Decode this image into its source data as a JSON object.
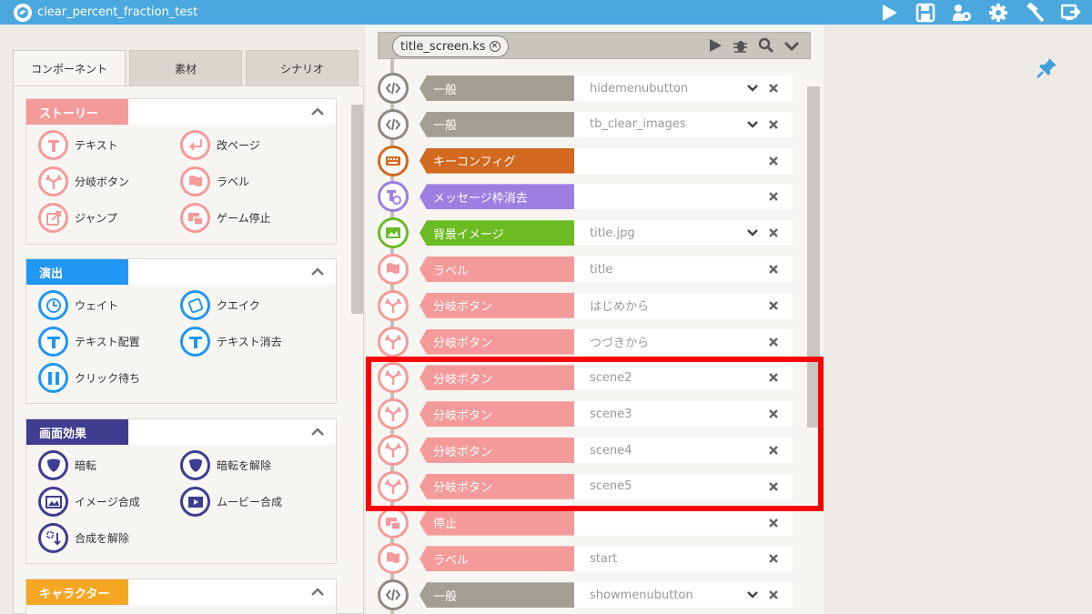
{
  "window": {
    "title": "clear_percent_fraction_test"
  },
  "titlebar_tools": [
    "play-icon",
    "save-icon",
    "users-gear-icon",
    "settings-gear-icon",
    "hammer-icon",
    "export-icon"
  ],
  "left": {
    "tabs": [
      "コンポーネント",
      "素材",
      "シナリオ"
    ],
    "sections": [
      {
        "label": "ストーリー",
        "color": "#f59a9a",
        "items": [
          {
            "label": "テキスト",
            "icon": "text-T-icon"
          },
          {
            "label": "改ページ",
            "icon": "new-page-icon"
          },
          {
            "label": "分岐ボタン",
            "icon": "branch-icon"
          },
          {
            "label": "ラベル",
            "icon": "label-flag-icon"
          },
          {
            "label": "ジャンプ",
            "icon": "jump-icon"
          },
          {
            "label": "ゲーム停止",
            "icon": "stop-game-icon"
          }
        ]
      },
      {
        "label": "演出",
        "color": "#2196f3",
        "items": [
          {
            "label": "ウェイト",
            "icon": "clock-icon"
          },
          {
            "label": "クエイク",
            "icon": "quake-icon"
          },
          {
            "label": "テキスト配置",
            "icon": "text-place-icon"
          },
          {
            "label": "テキスト消去",
            "icon": "text-clear-icon"
          },
          {
            "label": "クリック待ち",
            "icon": "pause-icon"
          }
        ]
      },
      {
        "label": "画面効果",
        "color": "#3f3d8f",
        "items": [
          {
            "label": "暗転",
            "icon": "fade-out-icon"
          },
          {
            "label": "暗転を解除",
            "icon": "fade-in-icon"
          },
          {
            "label": "イメージ合成",
            "icon": "image-composite-icon"
          },
          {
            "label": "ムービー合成",
            "icon": "movie-composite-icon"
          },
          {
            "label": "合成を解除",
            "icon": "composite-release-icon"
          }
        ]
      },
      {
        "label": "キャラクター",
        "color": "#f5a623",
        "items": []
      }
    ]
  },
  "editor": {
    "file_tab": "title_screen.ks",
    "rows": [
      {
        "tag": "一般",
        "value": "hidemenubutton",
        "color": "#a39e93",
        "icon": "code-icon",
        "dropdown": true
      },
      {
        "tag": "一般",
        "value": "tb_clear_images",
        "color": "#a39e93",
        "icon": "code-icon",
        "dropdown": true
      },
      {
        "tag": "キーコンフィグ",
        "value": "",
        "color": "#d2691e",
        "icon": "keyboard-icon",
        "dropdown": false
      },
      {
        "tag": "メッセージ枠消去",
        "value": "",
        "color": "#9c7fe0",
        "icon": "message-clear-icon",
        "dropdown": false
      },
      {
        "tag": "背景イメージ",
        "value": "title.jpg",
        "color": "#6cbb22",
        "icon": "background-image-icon",
        "dropdown": true
      },
      {
        "tag": "ラベル",
        "value": "title",
        "color": "#f59a9a",
        "icon": "label-flag-icon",
        "dropdown": false
      },
      {
        "tag": "分岐ボタン",
        "value": "はじめから",
        "color": "#f59a9a",
        "icon": "branch-icon",
        "dropdown": false
      },
      {
        "tag": "分岐ボタン",
        "value": "つづきから",
        "color": "#f59a9a",
        "icon": "branch-icon",
        "dropdown": false
      },
      {
        "tag": "分岐ボタン",
        "value": "scene2",
        "color": "#f59a9a",
        "icon": "branch-icon",
        "dropdown": false
      },
      {
        "tag": "分岐ボタン",
        "value": "scene3",
        "color": "#f59a9a",
        "icon": "branch-icon",
        "dropdown": false
      },
      {
        "tag": "分岐ボタン",
        "value": "scene4",
        "color": "#f59a9a",
        "icon": "branch-icon",
        "dropdown": false
      },
      {
        "tag": "分岐ボタン",
        "value": "scene5",
        "color": "#f59a9a",
        "icon": "branch-icon",
        "dropdown": false
      },
      {
        "tag": "停止",
        "value": "",
        "color": "#f59a9a",
        "icon": "stop-game-icon",
        "dropdown": false
      },
      {
        "tag": "ラベル",
        "value": "start",
        "color": "#f59a9a",
        "icon": "label-flag-icon",
        "dropdown": false
      },
      {
        "tag": "一般",
        "value": "showmenubutton",
        "color": "#a39e93",
        "icon": "code-icon",
        "dropdown": true
      }
    ]
  },
  "accent": {
    "highlight": "#ff0000",
    "titlebar": "#4aa8df"
  }
}
